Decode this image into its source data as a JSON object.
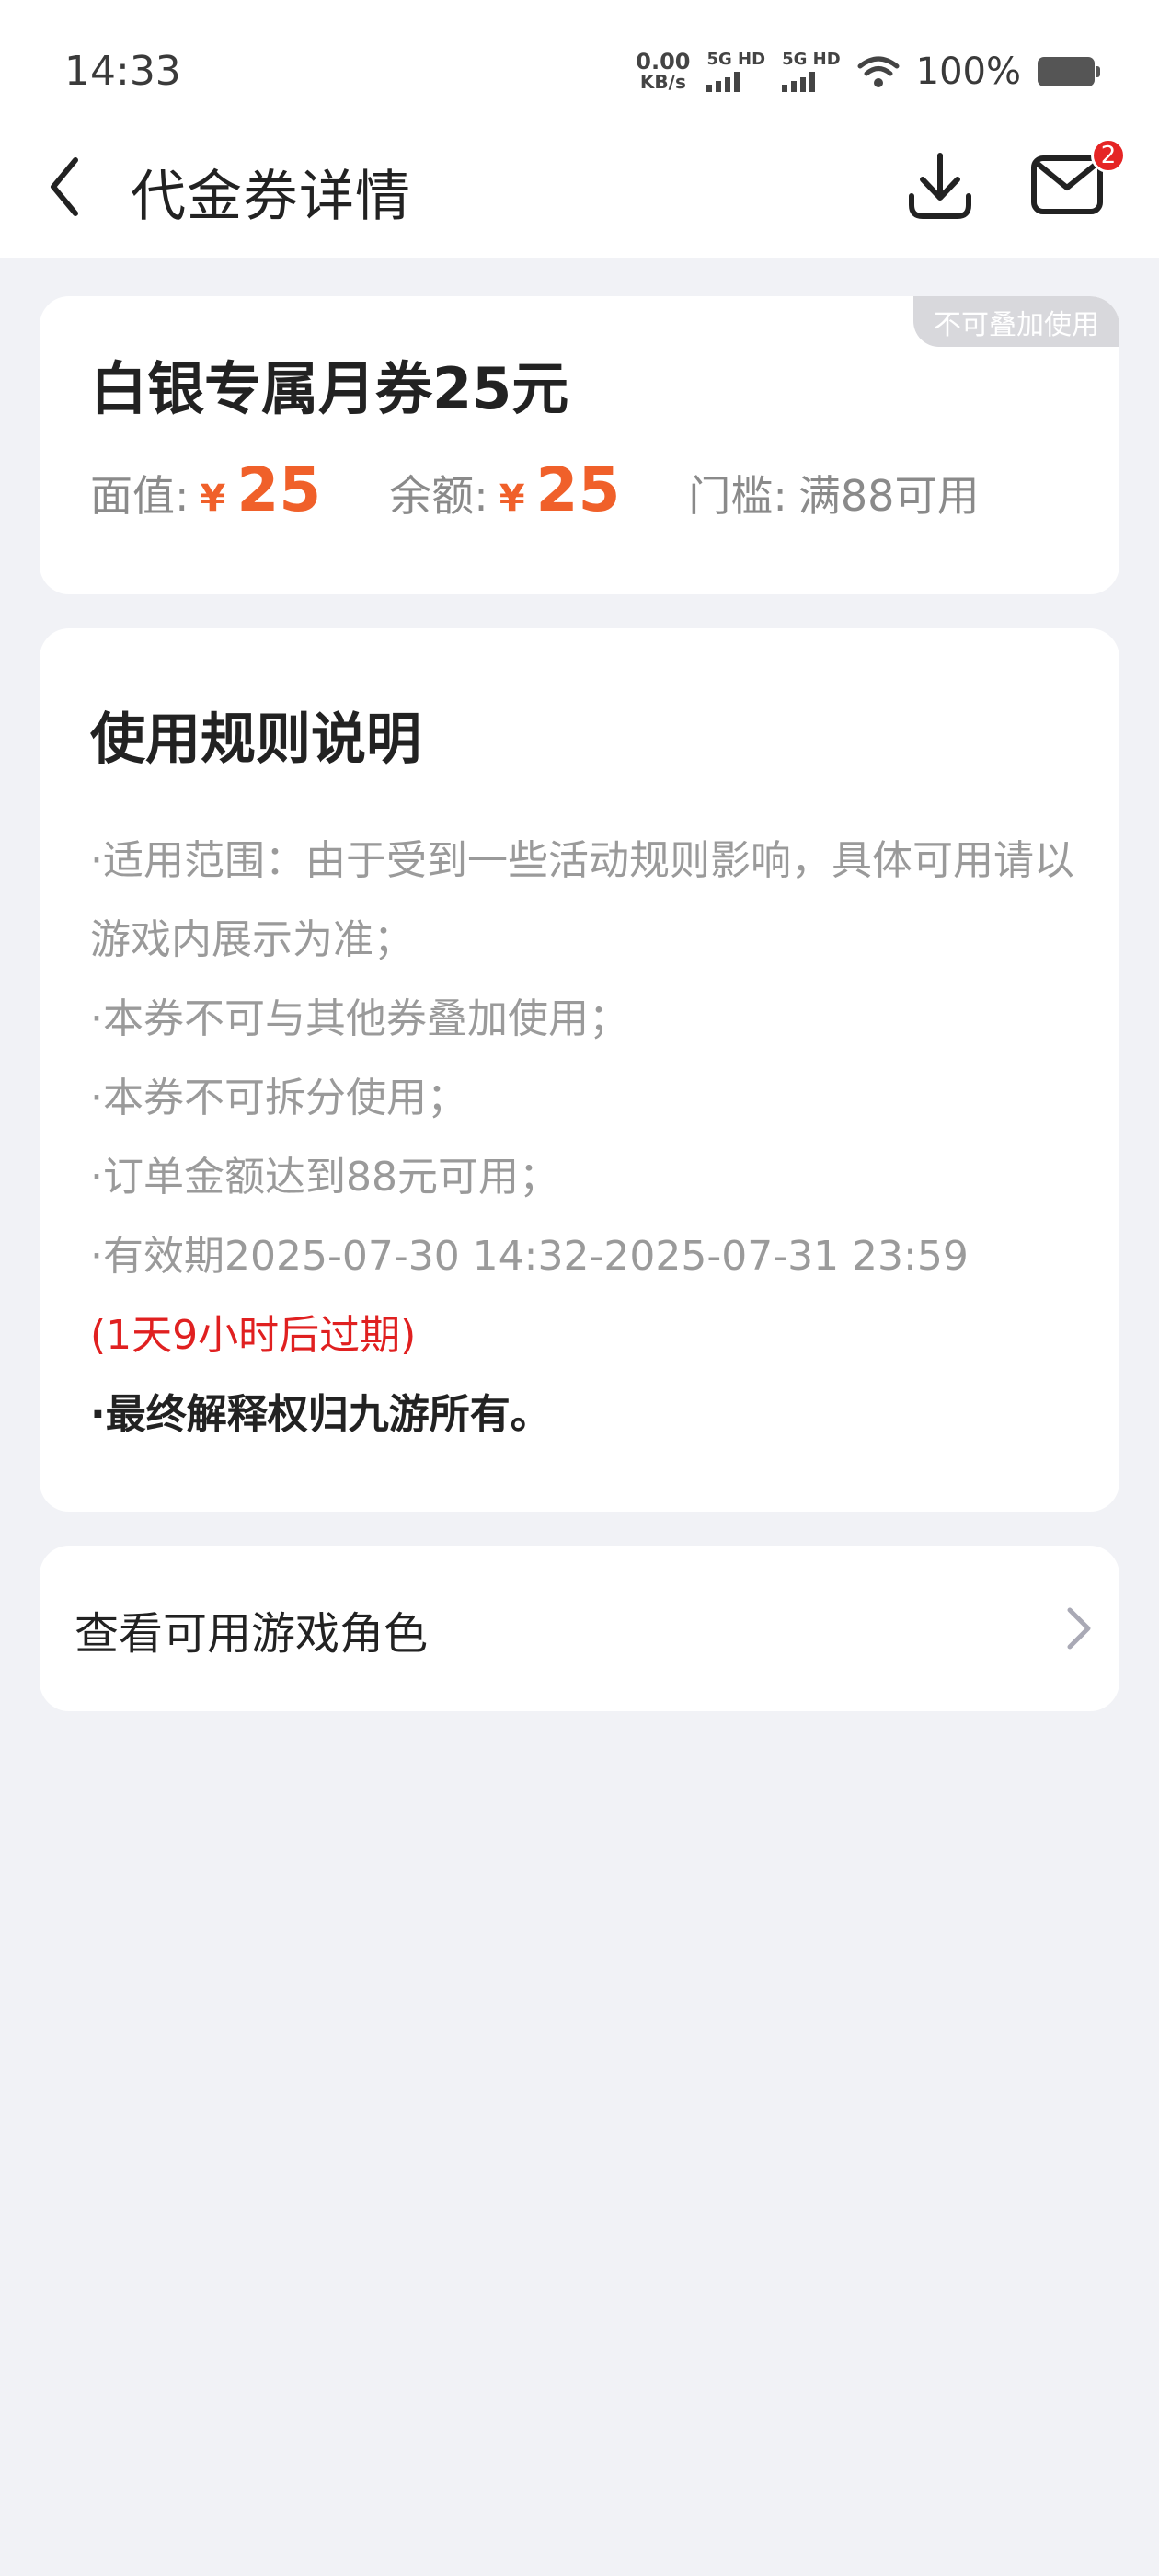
{
  "status_bar": {
    "time": "14:33",
    "net_speed_value": "0.00",
    "net_speed_unit": "KB/s",
    "sim1_label": "5G HD",
    "sim2_label": "5G HD",
    "battery_percent": "100%"
  },
  "nav": {
    "title": "代金券详情",
    "mail_badge_count": "2"
  },
  "coupon": {
    "tag": "不可叠加使用",
    "title": "白银专属月券25元",
    "face_value_label": "面值:",
    "currency": "¥",
    "face_value": "25",
    "balance_label": "余额:",
    "balance": "25",
    "threshold_label": "门槛:",
    "threshold_value": "满88可用"
  },
  "rules": {
    "title": "使用规则说明",
    "items": [
      "·适用范围：由于受到一些活动规则影响，具体可用请以游戏内展示为准；",
      "·本券不可与其他券叠加使用；",
      "·本券不可拆分使用；",
      "·订单金额达到88元可用；",
      "·有效期2025-07-30 14:32-2025-07-31 23:59"
    ],
    "expire_note": "(1天9小时后过期)",
    "final_note": "·最终解释权归九游所有。"
  },
  "roles_link": {
    "label": "查看可用游戏角色"
  },
  "colors": {
    "accent_orange": "#f0602a",
    "expire_red": "#e02020",
    "badge_red": "#e52424",
    "background": "#f1f2f6"
  },
  "icons": [
    "back-arrow-icon",
    "download-icon",
    "mail-icon",
    "chevron-right-icon",
    "wifi-icon",
    "battery-icon",
    "signal-icon"
  ]
}
